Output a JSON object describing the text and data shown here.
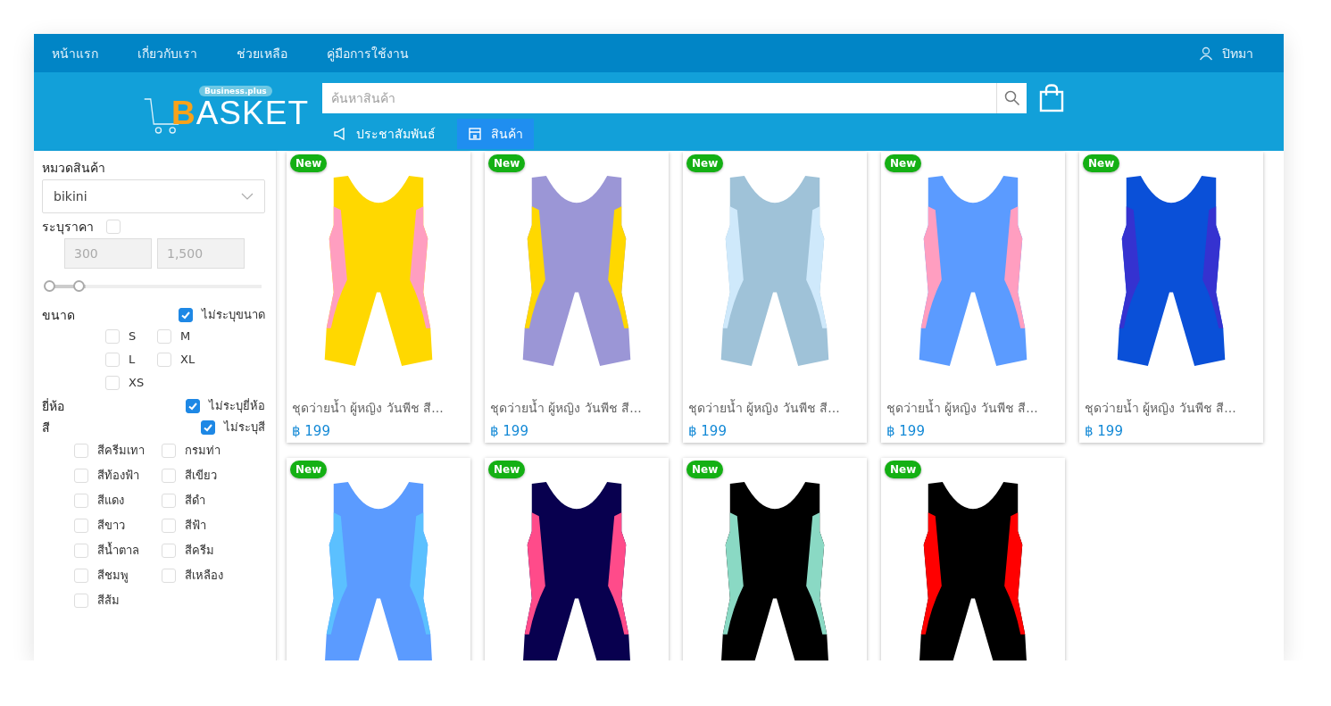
{
  "top_nav": {
    "links": [
      {
        "label": "หน้าแรก"
      },
      {
        "label": "เกี่ยวกับเรา"
      },
      {
        "label": "ช่วยเหลือ"
      },
      {
        "label": "คู่มือการใช้งาน"
      }
    ],
    "user": {
      "name": "ปิทมา"
    }
  },
  "header": {
    "logo": {
      "text": "BASKET",
      "badge": "Business.plus"
    },
    "search": {
      "placeholder": "ค้นหาสินค้า"
    },
    "tabs": [
      {
        "label": "ประชาสัมพันธ์",
        "kind": "announcements",
        "selected": false
      },
      {
        "label": "สินค้า",
        "kind": "store",
        "selected": true
      }
    ]
  },
  "sidebar": {
    "category": {
      "label": "หมวดสินค้า",
      "value": "bikini"
    },
    "price": {
      "label": "ระบุราคา",
      "checked": false,
      "min": "300",
      "max": "1,500",
      "disabled": true,
      "thumbs": [
        {
          "level": 0
        },
        {
          "level": 0.15
        }
      ]
    },
    "size": {
      "label": "ขนาด",
      "any": {
        "label": "ไม่ระบุขนาด",
        "checked": true
      },
      "options": [
        {
          "label": "S",
          "checked": false
        },
        {
          "label": "M",
          "checked": false
        },
        {
          "label": "L",
          "checked": false
        },
        {
          "label": "XL",
          "checked": false
        },
        {
          "label": "XS",
          "checked": false
        }
      ]
    },
    "brand": {
      "label": "ยี่ห้อ",
      "any": {
        "label": "ไม่ระบุยี่ห้อ",
        "checked": true
      }
    },
    "color": {
      "label": "สี",
      "any": {
        "label": "ไม่ระบุสี",
        "checked": true
      },
      "options": [
        {
          "label": "สีครีมเทา",
          "checked": false
        },
        {
          "label": "กรมท่า",
          "checked": false
        },
        {
          "label": "สีท้องฟ้า",
          "checked": false
        },
        {
          "label": "สีเขียว",
          "checked": false
        },
        {
          "label": "สีแดง",
          "checked": false
        },
        {
          "label": "สีดำ",
          "checked": false
        },
        {
          "label": "สีขาว",
          "checked": false
        },
        {
          "label": "สีฟ้า",
          "checked": false
        },
        {
          "label": "สีน้ำตาล",
          "checked": false
        },
        {
          "label": "สีครีม",
          "checked": false
        },
        {
          "label": "สีชมพู",
          "checked": false
        },
        {
          "label": "สีเหลือง",
          "checked": false
        },
        {
          "label": "สีส้ม",
          "checked": false
        }
      ]
    }
  },
  "products": [
    {
      "badge": "New",
      "color": "#ffd800",
      "trim": {
        "color": "#ff9ec0"
      },
      "title": "ชุดว่ายน้ำ ผู้หญิง วันพีช สี...",
      "price": "฿ 199"
    },
    {
      "badge": "New",
      "color": "#9b96d6",
      "trim": {
        "color": "#ffd800"
      },
      "title": "ชุดว่ายน้ำ ผู้หญิง วันพีช สี...",
      "price": "฿ 199"
    },
    {
      "badge": "New",
      "color": "#9fc2d8",
      "trim": {
        "color": "#cfe9fb"
      },
      "title": "ชุดว่ายน้ำ ผู้หญิง วันพีช สี...",
      "price": "฿ 199"
    },
    {
      "badge": "New",
      "color": "#5b9bff",
      "trim": {
        "color": "#ff9ec0"
      },
      "title": "ชุดว่ายน้ำ ผู้หญิง วันพีช สี...",
      "price": "฿ 199"
    },
    {
      "badge": "New",
      "color": "#0a50d8",
      "trim": {
        "color": "#3532d0"
      },
      "title": "ชุดว่ายน้ำ ผู้หญิง วันพีช สี...",
      "price": "฿ 199"
    },
    {
      "badge": "New",
      "color": "#5b9bff",
      "trim": {
        "color": "#5bc0ff"
      }
    },
    {
      "badge": "New",
      "color": "#08004f",
      "trim": {
        "color": "#ff4b8a"
      }
    },
    {
      "badge": "New",
      "color": "#000000",
      "trim": {
        "color": "#8ad9c4"
      }
    },
    {
      "badge": "New",
      "color": "#000000",
      "trim": {
        "color": "#ff0000"
      }
    }
  ]
}
